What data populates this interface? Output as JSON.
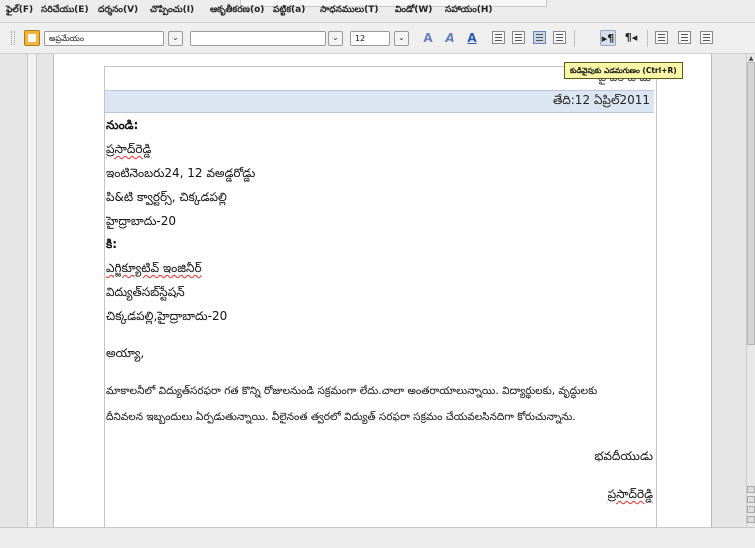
{
  "menu": [
    {
      "id": "file",
      "label": "ఫైల్(F)"
    },
    {
      "id": "edit",
      "label": "సరిచేయు(E)"
    },
    {
      "id": "view",
      "label": "దర్శనం(V)"
    },
    {
      "id": "insert",
      "label": "చొప్పించు(I)"
    },
    {
      "id": "format",
      "label": "ఆకృతీకరణ(o)"
    },
    {
      "id": "table",
      "label": "పట్టిక(a)"
    },
    {
      "id": "tools",
      "label": "సాధనములు(T)"
    },
    {
      "id": "window",
      "label": "విండో(W)"
    },
    {
      "id": "help",
      "label": "సహాయం(H)"
    }
  ],
  "toolbar": {
    "paragraph_style": "అప్రమేయం",
    "font_name": "",
    "font_size": "12",
    "icons": {
      "styles": "styles-icon",
      "font_effect_1": "fontwork-icon",
      "font_effect_2": "italic-effect-icon",
      "font_color": "font-color-icon",
      "align_left": "align-left-icon",
      "align_center": "align-center-icon",
      "align_right": "align-right-icon",
      "justify": "justify-icon",
      "ltr": "left-to-right-icon",
      "rtl": "right-to-left-icon",
      "numbering": "numbering-icon",
      "bullets": "bullets-icon",
      "indent": "decrease-indent-icon"
    },
    "glyphs": {
      "a1": "A",
      "a2": "A",
      "a3": "A",
      "ltr": "▸¶",
      "rtl": "¶◂"
    }
  },
  "tooltip": "కుడివైపుకు ఎడమగుణం (Ctrl+R)",
  "document": {
    "header_text": "హైదరాబాదు",
    "date": "తేది:12 ఏప్రిల్2011",
    "from_label": "నుండి:",
    "sender_name": "ప్రసాద్‌రెడ్డి",
    "sender_addr1": "ఇంటినెంబరు24, 12 వఅడ్డరోడ్డు",
    "sender_addr2": "పి&టి క్వార్టర్స్, చిక్కడపల్లి",
    "sender_city": "హైద్రాబాదు-20",
    "to_label": "కి:",
    "recipient_title": "ఎగ్జిక్యూటివ్ ఇంజినీర్",
    "recipient_office": "విద్యుత్‌సబ్‌స్టేషన్",
    "recipient_city": "చిక్కడపల్లి,హైద్రాబాదు-20",
    "salutation": "అయ్యా,",
    "body_line1": "మాకాలనీలో విద్యుత్‌సరఫరా గత కొన్ని రోజులనుండి సక్రమంగా లేదు.చాలా అంతరాయాలున్నాయి. విద్యార్థులకు, వృద్ధులకు",
    "body_line2": "దీనివలన ఇబ్బందులు ఏర్పడుతున్నాయి. వీలైనంత త్వరలో విద్యుత్ సరఫరా సక్రమం చేయవలసినదిగా కోరుచున్నాను.",
    "closing": "భవదీయుడు",
    "signature": "ప్రసాద్‌రెడ్డి"
  }
}
